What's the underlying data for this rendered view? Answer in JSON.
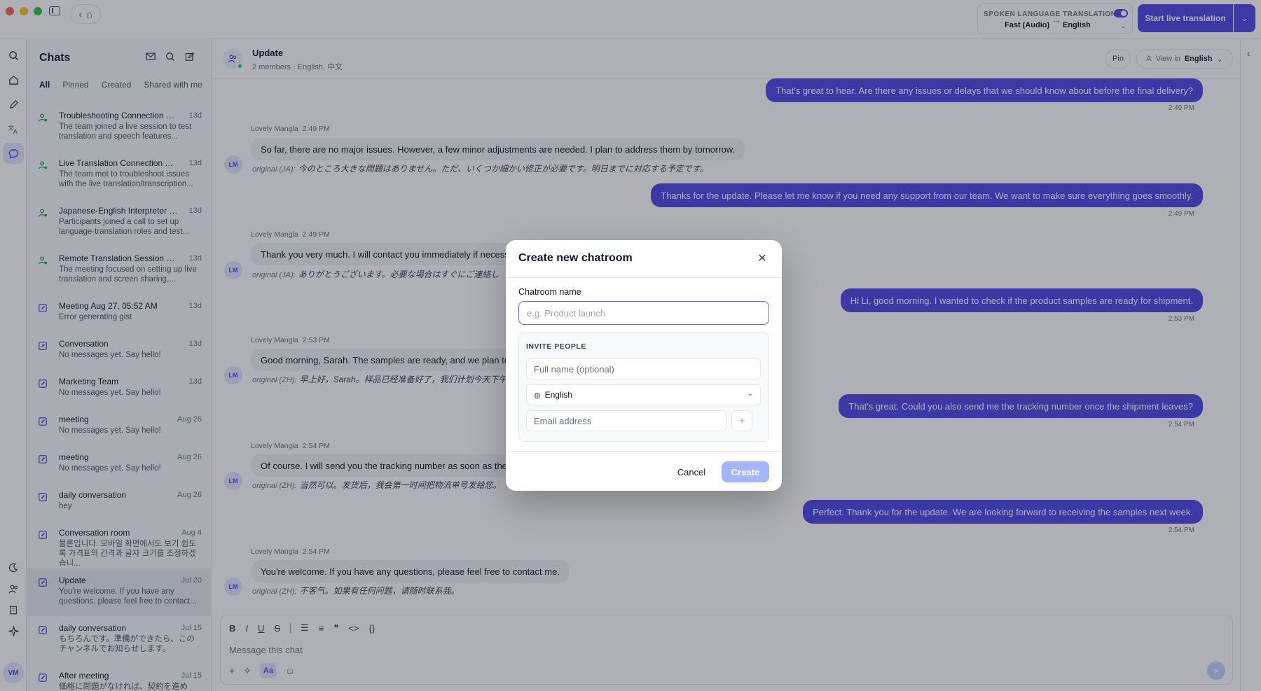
{
  "topbar": {
    "spoken_label": "SPOKEN LANGUAGE",
    "spoken_value": "Fast (Audio)",
    "translation_label": "TRANSLATION",
    "translation_value": "English",
    "start_button": "Start live translation"
  },
  "chatlist": {
    "title": "Chats",
    "filters": [
      "All",
      "Pinned",
      "Created",
      "Shared with me"
    ],
    "items": [
      {
        "title": "Troubleshooting Connection an...",
        "date": "13d",
        "sub": "The team joined a live session to test translation and speech features..."
      },
      {
        "title": "Live Translation Connection Tro...",
        "date": "13d",
        "sub": "The team met to troubleshoot issues with the live translation/transcription..."
      },
      {
        "title": "Japanese-English Interpreter Co...",
        "date": "13d",
        "sub": "Participants joined a call to set up language-translation roles and test..."
      },
      {
        "title": "Remote Translation Session Set...",
        "date": "13d",
        "sub": "The meeting focused on setting up live translation and screen sharing,..."
      },
      {
        "title": "Meeting Aug 27, 05:52 AM",
        "date": "13d",
        "sub": "Error generating gist"
      },
      {
        "title": "Conversation",
        "date": "13d",
        "sub": "No messages yet. Say hello!"
      },
      {
        "title": "Marketing Team",
        "date": "13d",
        "sub": "No messages yet. Say hello!"
      },
      {
        "title": "meeting",
        "date": "Aug 26",
        "sub": "No messages yet. Say hello!"
      },
      {
        "title": "meeting",
        "date": "Aug 26",
        "sub": "No messages yet. Say hello!"
      },
      {
        "title": "daily conversation",
        "date": "Aug 26",
        "sub": "hey"
      },
      {
        "title": "Conversation room",
        "date": "Aug 4",
        "sub": "물론입니다. 모바일 화면에서도 보기 쉽도록 가격표의 간격과 글자 크기를 조정하겠습니..."
      },
      {
        "title": "Update",
        "date": "Jul 20",
        "sub": "You're welcome. If you have any questions, please feel free to contact..."
      },
      {
        "title": "daily conversation",
        "date": "Jul 15",
        "sub": "もちろんです。準備ができたら、このチャンネルでお知らせします。"
      },
      {
        "title": "After meeting",
        "date": "Jul 15",
        "sub": "価格に問題がなければ、契約を進めて..."
      }
    ]
  },
  "room": {
    "title": "Update",
    "meta": "2 members · English, 中文",
    "pin": "Pin",
    "view_in_label": "View in",
    "view_in_value": "English"
  },
  "messages": {
    "out1": "That's great to hear. Are there any issues or delays that we should know about before the final delivery?",
    "out1_time": "2:49 PM",
    "in1_sender": "Lovely Mangla",
    "in1_time": "2:49 PM",
    "in1_text": "So far, there are no major issues. However, a few minor adjustments are needed. I plan to address them by tomorrow.",
    "in1_orig_label": "original (JA):",
    "in1_orig": "今のところ大きな問題はありません。ただ、いくつか細かい修正が必要です。明日までに対応する予定です。",
    "out2": "Thanks for the update. Please let me know if you need any support from our team. We want to make sure everything goes smoothly.",
    "out2_time": "2:49 PM",
    "in2_sender": "Lovely Mangla",
    "in2_time": "2:49 PM",
    "in2_text": "Thank you very much. I will contact you immediately if necessa",
    "in2_orig_label": "original (JA):",
    "in2_orig": "ありがとうございます。必要な場合はすぐにご連絡し",
    "out3": "Hi Li, good morning. I wanted to check if the product samples are ready for shipment.",
    "out3_time": "2:53 PM",
    "in3_sender": "Lovely Mangla",
    "in3_time": "2:53 PM",
    "in3_text": "Good morning, Sarah. The samples are ready, and we plan to s",
    "in3_orig_label": "original (ZH):",
    "in3_orig": "早上好，Sarah。样品已经准备好了，我们计划今天下午",
    "out4": "That's great. Could you also send me the tracking number once the shipment leaves?",
    "out4_time": "2:54 PM",
    "in4_sender": "Lovely Mangla",
    "in4_time": "2:54 PM",
    "in4_text": "Of course. I will send you the tracking number as soon as the s",
    "in4_orig_label": "original (ZH):",
    "in4_orig": "当然可以。发货后，我会第一时间把物流单号发给您。",
    "out5": "Perfect. Thank you for the update. We are looking forward to receiving the samples next week.",
    "out5_time": "2:54 PM",
    "in5_sender": "Lovely Mangla",
    "in5_time": "2:54 PM",
    "in5_text": "You're welcome. If you have any questions, please feel free to contact me.",
    "in5_orig_label": "original (ZH):",
    "in5_orig": "不客气。如果有任何问题，请随时联系我。",
    "avatar_initials": "LM"
  },
  "composer": {
    "placeholder": "Message this chat",
    "aa": "Aa"
  },
  "user": {
    "initials": "VM"
  },
  "modal": {
    "title": "Create new chatroom",
    "name_label": "Chatroom name",
    "name_placeholder": "e.g. Product launch",
    "invite_label": "INVITE PEOPLE",
    "fullname_placeholder": "Full name (optional)",
    "language": "English",
    "email_placeholder": "Email address",
    "cancel": "Cancel",
    "create": "Create"
  },
  "colors": {
    "accent": "#4f46e5",
    "accent_disabled": "#a5b4fc",
    "online": "#22c55e"
  }
}
